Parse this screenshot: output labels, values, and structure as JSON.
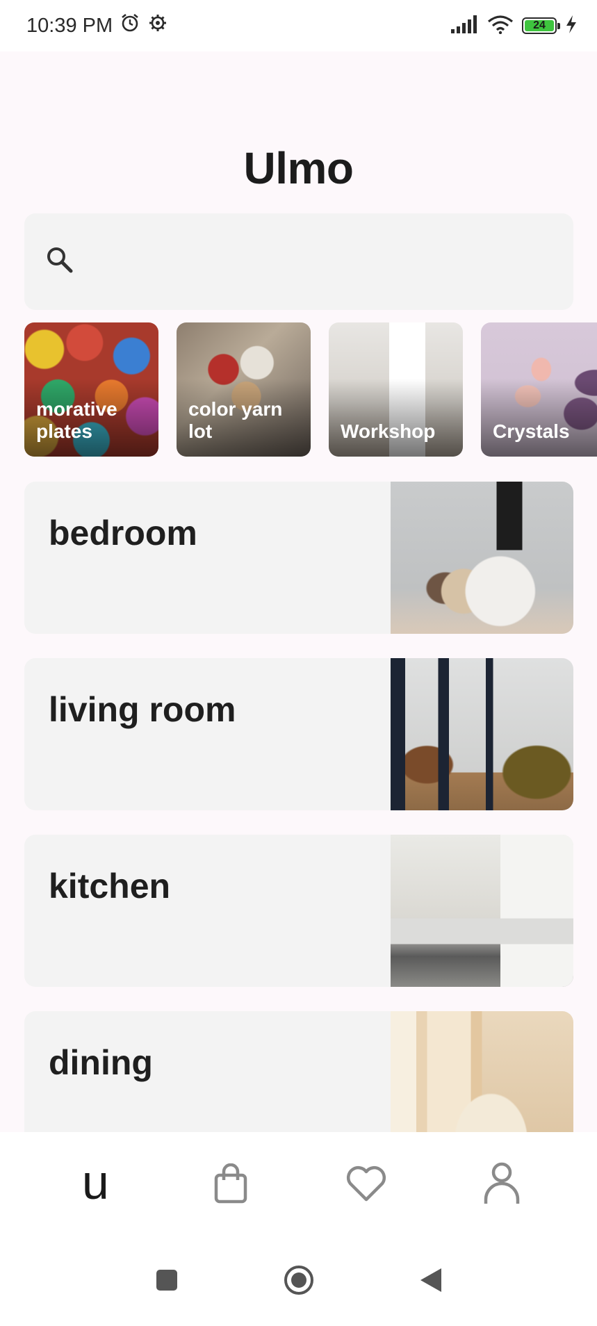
{
  "status_bar": {
    "time": "10:39 PM",
    "battery_level": "24",
    "icons": [
      "alarm-icon",
      "settings-icon",
      "signal-icon",
      "wifi-icon",
      "battery-icon",
      "charging-icon"
    ]
  },
  "header": {
    "title": "Ulmo"
  },
  "search": {
    "placeholder": "",
    "icon": "search-icon"
  },
  "categories": [
    {
      "label": "morative\nplates"
    },
    {
      "label": "color yarn\nlot"
    },
    {
      "label": "Workshop"
    },
    {
      "label": "Crystals"
    }
  ],
  "rooms": [
    {
      "title": "bedroom"
    },
    {
      "title": "living room"
    },
    {
      "title": "kitchen"
    },
    {
      "title": "dining"
    }
  ],
  "bottom_nav": {
    "home_glyph": "u",
    "items": [
      "home-logo",
      "bag-icon",
      "heart-icon",
      "profile-icon"
    ]
  },
  "system_nav": [
    "recents-button",
    "home-button",
    "back-button"
  ],
  "colors": {
    "background": "#fdf8fb",
    "card": "#f3f3f3",
    "text": "#1c1c1c",
    "icon_gray": "#8a8a8a",
    "battery_green": "#3ec43e"
  }
}
